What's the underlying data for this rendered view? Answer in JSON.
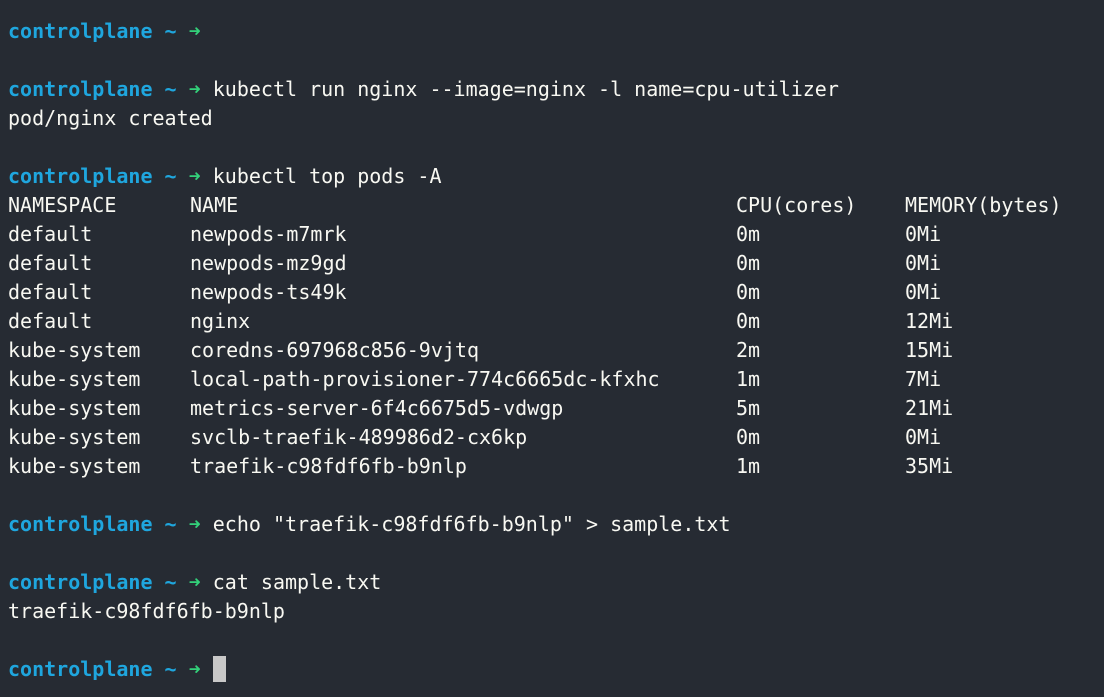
{
  "prompt": {
    "host": "controlplane",
    "tilde": "~",
    "arrow": "➜"
  },
  "commands": {
    "run": "kubectl run nginx --image=nginx -l name=cpu-utilizer",
    "run_output": "pod/nginx created",
    "top": "kubectl top pods -A",
    "echo": "echo \"traefik-c98fdf6fb-b9nlp\" > sample.txt",
    "cat": "cat sample.txt",
    "cat_output": "traefik-c98fdf6fb-b9nlp"
  },
  "table": {
    "headers": {
      "namespace": "NAMESPACE",
      "name": "NAME",
      "cpu": "CPU(cores)",
      "memory": "MEMORY(bytes)"
    },
    "rows": [
      {
        "namespace": "default",
        "name": "newpods-m7mrk",
        "cpu": "0m",
        "memory": "0Mi"
      },
      {
        "namespace": "default",
        "name": "newpods-mz9gd",
        "cpu": "0m",
        "memory": "0Mi"
      },
      {
        "namespace": "default",
        "name": "newpods-ts49k",
        "cpu": "0m",
        "memory": "0Mi"
      },
      {
        "namespace": "default",
        "name": "nginx",
        "cpu": "0m",
        "memory": "12Mi"
      },
      {
        "namespace": "kube-system",
        "name": "coredns-697968c856-9vjtq",
        "cpu": "2m",
        "memory": "15Mi"
      },
      {
        "namespace": "kube-system",
        "name": "local-path-provisioner-774c6665dc-kfxhc",
        "cpu": "1m",
        "memory": "7Mi"
      },
      {
        "namespace": "kube-system",
        "name": "metrics-server-6f4c6675d5-vdwgp",
        "cpu": "5m",
        "memory": "21Mi"
      },
      {
        "namespace": "kube-system",
        "name": "svclb-traefik-489986d2-cx6kp",
        "cpu": "0m",
        "memory": "0Mi"
      },
      {
        "namespace": "kube-system",
        "name": "traefik-c98fdf6fb-b9nlp",
        "cpu": "1m",
        "memory": "35Mi"
      }
    ]
  },
  "colors": {
    "background": "#262b33",
    "prompt_host": "#1fa6de",
    "prompt_arrow": "#33d17a",
    "text": "#f8f8f2",
    "cursor": "#c8c8c8"
  }
}
